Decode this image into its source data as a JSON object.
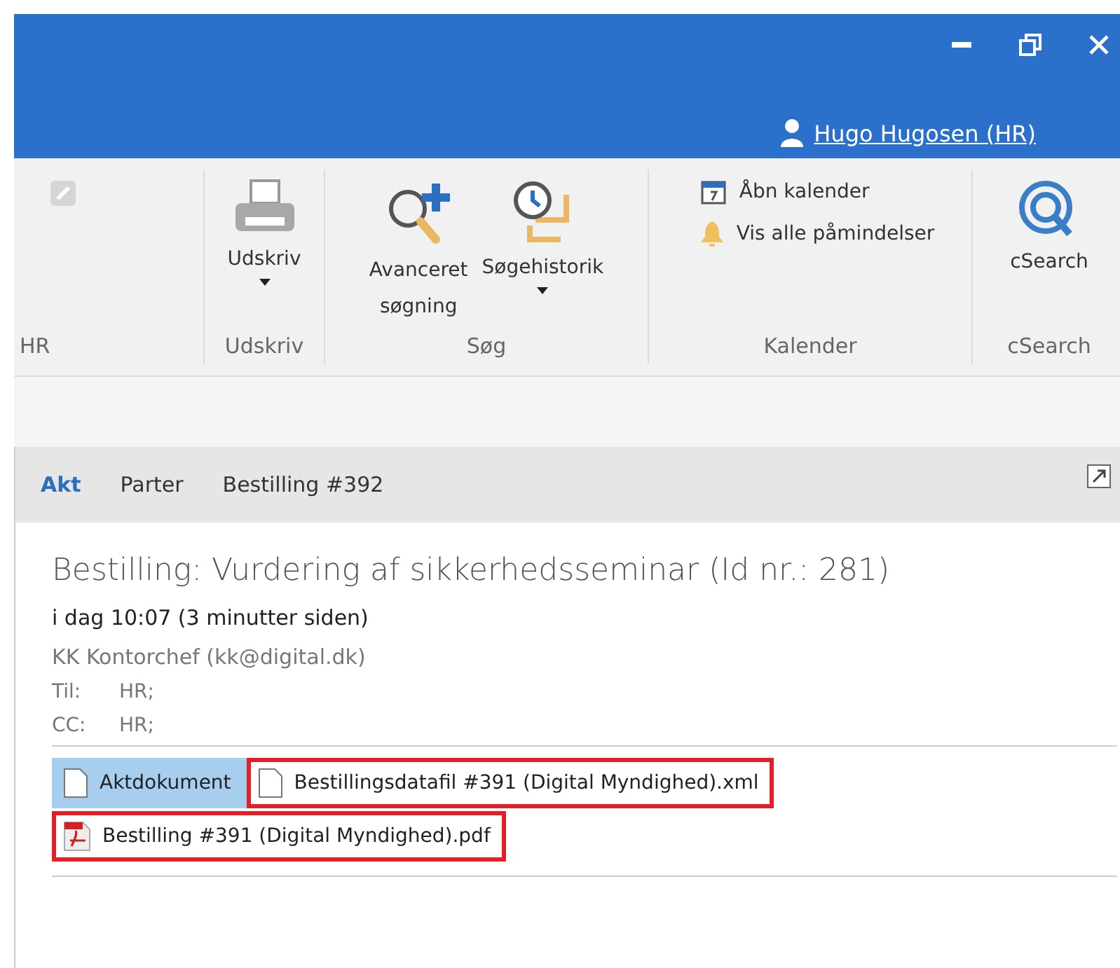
{
  "user": {
    "name": "Hugo Hugosen (HR)"
  },
  "ribbon": {
    "groups": [
      {
        "label": "HR",
        "buttons": [
          {
            "kind": "faded"
          }
        ]
      },
      {
        "label": "Udskriv",
        "buttons": [
          {
            "kind": "large",
            "lines": [
              "Udskriv"
            ],
            "dropdown": true
          }
        ]
      },
      {
        "label": "Søg",
        "buttons": [
          {
            "kind": "large",
            "lines": [
              "Avanceret",
              "søgning"
            ],
            "dropdown": false
          },
          {
            "kind": "large",
            "lines": [
              "Søgehistorik"
            ],
            "dropdown": true
          }
        ]
      },
      {
        "label": "Kalender",
        "buttons": [
          {
            "kind": "small",
            "lines": [
              "Åbn kalender"
            ]
          },
          {
            "kind": "small",
            "lines": [
              "Vis alle påmindelser"
            ]
          }
        ]
      },
      {
        "label": "cSearch",
        "buttons": [
          {
            "kind": "large",
            "lines": [
              "cSearch"
            ],
            "dropdown": false
          }
        ]
      }
    ]
  },
  "tabs": [
    {
      "label": "Akt",
      "selected": true
    },
    {
      "label": "Parter",
      "selected": false
    },
    {
      "label": "Bestilling #392",
      "selected": false
    }
  ],
  "message": {
    "subject": "Bestilling: Vurdering af sikkerhedsseminar (Id nr.: 281)",
    "date": "i dag 10:07 (3 minutter siden)",
    "sender": "KK Kontorchef (kk@digital.dk)",
    "recipients": [
      {
        "label": "Til:",
        "value": "HR;"
      },
      {
        "label": "CC:",
        "value": "HR;"
      }
    ]
  },
  "attachments": [
    {
      "name": "Aktdokument",
      "kind": "doc",
      "selected": true,
      "highlighted": false
    },
    {
      "name": "Bestillingsdatafil #391 (Digital Myndighed).xml",
      "kind": "doc",
      "selected": false,
      "highlighted": true
    },
    {
      "name": "Bestilling #391 (Digital Myndighed).pdf",
      "kind": "pdf",
      "selected": false,
      "highlighted": true
    }
  ]
}
